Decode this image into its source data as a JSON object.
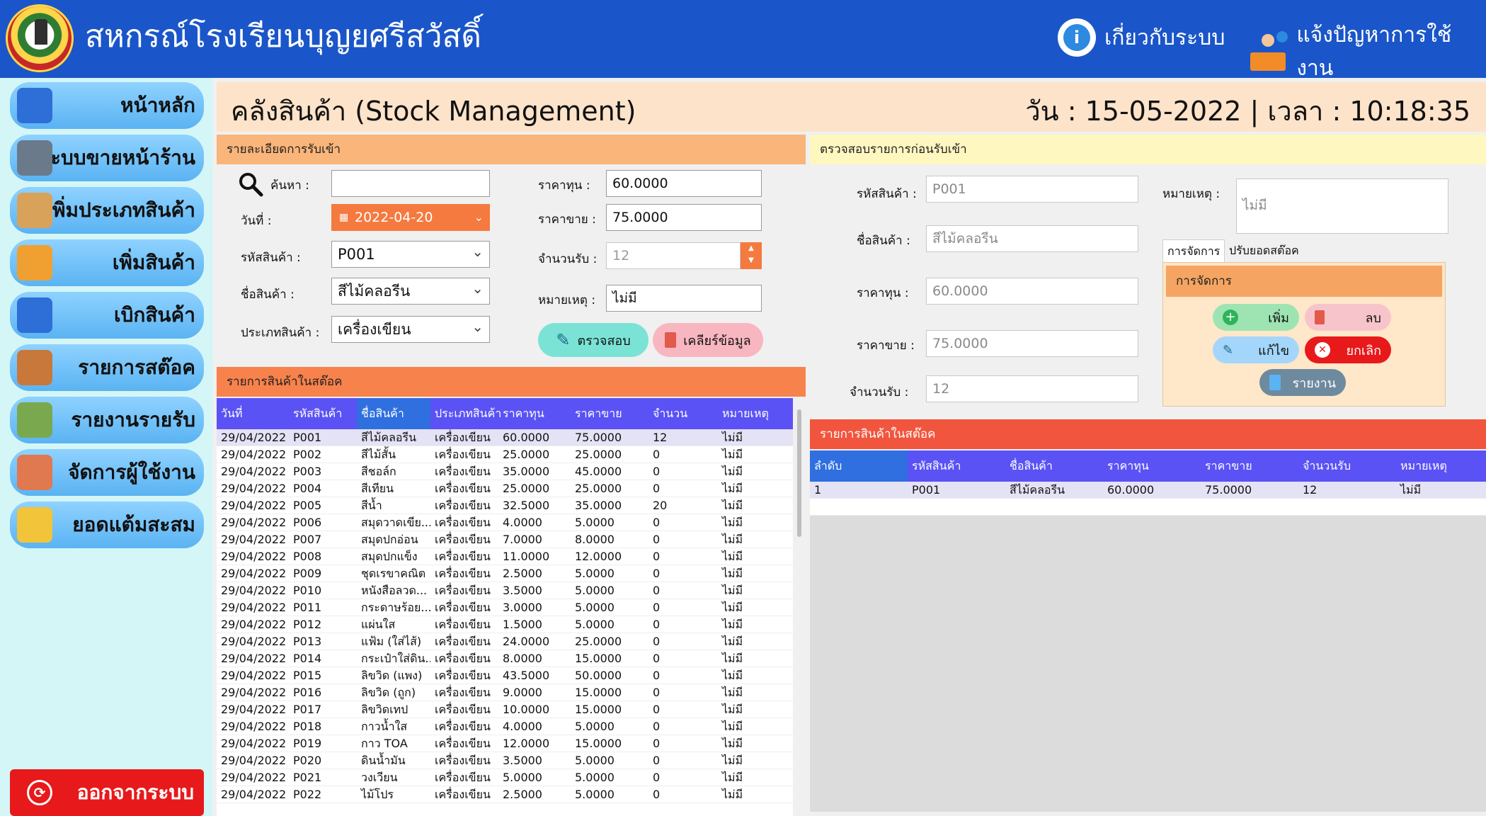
{
  "app": {
    "title": "สหกรณ์โรงเรียนบุญยศรีสวัสดิ์",
    "about_label": "เกี่ยวกับระบบ",
    "report_issue_label": "แจ้งปัญหาการใช้งาน"
  },
  "sidebar": {
    "items": [
      {
        "label": "หน้าหลัก",
        "icon": "dashboard-icon",
        "color": "#2d6fd6"
      },
      {
        "label": "ระบบขายหน้าร้าน",
        "icon": "cash-register-icon",
        "color": "#6b7a8a"
      },
      {
        "label": "เพิ่มประเภทสินค้า",
        "icon": "shelf-icon",
        "color": "#d9a25a"
      },
      {
        "label": "เพิ่มสินค้า",
        "icon": "basket-add-icon",
        "color": "#f0a030"
      },
      {
        "label": "เบิกสินค้า",
        "icon": "share-icon",
        "color": "#2d6fd6"
      },
      {
        "label": "รายการสต๊อค",
        "icon": "boxes-icon",
        "color": "#c8783a"
      },
      {
        "label": "รายงานรายรับ",
        "icon": "calculator-icon",
        "color": "#7aa84e"
      },
      {
        "label": "จัดการผู้ใช้งาน",
        "icon": "users-icon",
        "color": "#e07850"
      },
      {
        "label": "ยอดแต้มสะสม",
        "icon": "star-hand-icon",
        "color": "#f2c43a"
      }
    ],
    "logout_label": "ออกจากระบบ"
  },
  "header": {
    "title": "คลังสินค้า (Stock Management)",
    "datetime": "วัน : 15-05-2022 | เวลา : 10:18:35"
  },
  "receive_form": {
    "section_title": "รายละเอียดการรับเข้า",
    "search_label": "ค้นหา :",
    "search_value": "",
    "date_label": "วันที่ :",
    "date_value": "2022-04-20",
    "code_label": "รหัสสินค้า :",
    "code_value": "P001",
    "name_label": "ชื่อสินค้า :",
    "name_value": "สีไม้คลอรีน",
    "category_label": "ประเภทสินค้า :",
    "category_value": "เครื่องเขียน",
    "cost_label": "ราคาทุน :",
    "cost_value": "60.0000",
    "price_label": "ราคาขาย :",
    "price_value": "75.0000",
    "qty_label": "จำนวนรับ :",
    "qty_value": "12",
    "note_label": "หมายเหตุ :",
    "note_value": "ไม่มี",
    "check_button": "ตรวจสอบ",
    "clear_button": "เคลียร์ข้อมูล"
  },
  "stock_table": {
    "section_title": "รายการสินค้าในสต๊อค",
    "columns": [
      "วันที่",
      "รหัสสินค้า",
      "ชื่อสินค้า",
      "ประเภทสินค้า",
      "ราคาทุน",
      "ราคาขาย",
      "จำนวน",
      "หมายเหตุ"
    ],
    "rows": [
      [
        "29/04/2022",
        "P001",
        "สีไม้คลอรีน",
        "เครื่องเขียน",
        "60.0000",
        "75.0000",
        "12",
        "ไม่มี"
      ],
      [
        "29/04/2022",
        "P002",
        "สีไม้สั้น",
        "เครื่องเขียน",
        "25.0000",
        "25.0000",
        "0",
        "ไม่มี"
      ],
      [
        "29/04/2022",
        "P003",
        "สีชอล์ก",
        "เครื่องเขียน",
        "35.0000",
        "45.0000",
        "0",
        "ไม่มี"
      ],
      [
        "29/04/2022",
        "P004",
        "สีเทียน",
        "เครื่องเขียน",
        "25.0000",
        "25.0000",
        "0",
        "ไม่มี"
      ],
      [
        "29/04/2022",
        "P005",
        "สีน้ำ",
        "เครื่องเขียน",
        "32.5000",
        "35.0000",
        "20",
        "ไม่มี"
      ],
      [
        "29/04/2022",
        "P006",
        "สมุดวาดเขีย...",
        "เครื่องเขียน",
        "4.0000",
        "5.0000",
        "0",
        "ไม่มี"
      ],
      [
        "29/04/2022",
        "P007",
        "สมุดปกอ่อน",
        "เครื่องเขียน",
        "7.0000",
        "8.0000",
        "0",
        "ไม่มี"
      ],
      [
        "29/04/2022",
        "P008",
        "สมุดปกแข็ง",
        "เครื่องเขียน",
        "11.0000",
        "12.0000",
        "0",
        "ไม่มี"
      ],
      [
        "29/04/2022",
        "P009",
        "ชุดเรขาคณิต",
        "เครื่องเขียน",
        "2.5000",
        "5.0000",
        "0",
        "ไม่มี"
      ],
      [
        "29/04/2022",
        "P010",
        "หนังสือลวด...",
        "เครื่องเขียน",
        "3.5000",
        "5.0000",
        "0",
        "ไม่มี"
      ],
      [
        "29/04/2022",
        "P011",
        "กระดาษร้อย...",
        "เครื่องเขียน",
        "3.0000",
        "5.0000",
        "0",
        "ไม่มี"
      ],
      [
        "29/04/2022",
        "P012",
        "แผ่นใส",
        "เครื่องเขียน",
        "1.5000",
        "5.0000",
        "0",
        "ไม่มี"
      ],
      [
        "29/04/2022",
        "P013",
        "แฟ้ม (ใส่ไส้)",
        "เครื่องเขียน",
        "24.0000",
        "25.0000",
        "0",
        "ไม่มี"
      ],
      [
        "29/04/2022",
        "P014",
        "กระเป๋าใส่ดิน...",
        "เครื่องเขียน",
        "8.0000",
        "15.0000",
        "0",
        "ไม่มี"
      ],
      [
        "29/04/2022",
        "P015",
        "ลิขวิด (แพง)",
        "เครื่องเขียน",
        "43.5000",
        "50.0000",
        "0",
        "ไม่มี"
      ],
      [
        "29/04/2022",
        "P016",
        "ลิขวิด (ถูก)",
        "เครื่องเขียน",
        "9.0000",
        "15.0000",
        "0",
        "ไม่มี"
      ],
      [
        "29/04/2022",
        "P017",
        "ลิขวิดเทป",
        "เครื่องเขียน",
        "10.0000",
        "15.0000",
        "0",
        "ไม่มี"
      ],
      [
        "29/04/2022",
        "P018",
        "กาวน้ำใส",
        "เครื่องเขียน",
        "4.0000",
        "5.0000",
        "0",
        "ไม่มี"
      ],
      [
        "29/04/2022",
        "P019",
        "กาว TOA",
        "เครื่องเขียน",
        "12.0000",
        "15.0000",
        "0",
        "ไม่มี"
      ],
      [
        "29/04/2022",
        "P020",
        "ดินน้ำมัน",
        "เครื่องเขียน",
        "3.5000",
        "5.0000",
        "0",
        "ไม่มี"
      ],
      [
        "29/04/2022",
        "P021",
        "วงเวียน",
        "เครื่องเขียน",
        "5.0000",
        "5.0000",
        "0",
        "ไม่มี"
      ],
      [
        "29/04/2022",
        "P022",
        "ไม้โปร",
        "เครื่องเขียน",
        "2.5000",
        "5.0000",
        "0",
        "ไม่มี"
      ]
    ]
  },
  "check_panel": {
    "section_title": "ตรวจสอบรายการก่อนรับเข้า",
    "code_label": "รหัสสินค้า :",
    "code_value": "P001",
    "name_label": "ชื่อสินค้า :",
    "name_value": "สีไม้คลอรีน",
    "cost_label": "ราคาทุน :",
    "cost_value": "60.0000",
    "price_label": "ราคาขาย :",
    "price_value": "75.0000",
    "qty_label": "จำนวนรับ :",
    "qty_value": "12",
    "note_label": "หมายเหตุ :",
    "note_value": "ไม่มี",
    "tabs": [
      "การจัดการ",
      "ปรับยอดสต๊อค"
    ],
    "actions_title": "การจัดการ",
    "add_button": "เพิ่ม",
    "delete_button": "ลบ",
    "edit_button": "แก้ไข",
    "cancel_button": "ยกเลิก",
    "report_button": "รายงาน"
  },
  "pending_table": {
    "section_title": "รายการสินค้าในสต๊อค",
    "columns": [
      "ลำดับ",
      "รหัสสินค้า",
      "ชื่อสินค้า",
      "ราคาทุน",
      "ราคาขาย",
      "จำนวนรับ",
      "หมายเหตุ"
    ],
    "rows": [
      [
        "1",
        "P001",
        "สีไม้คลอรีน",
        "60.0000",
        "75.0000",
        "12",
        "ไม่มี"
      ]
    ]
  },
  "colors": {
    "topbar": "#1a56c9",
    "sidebar_bg": "#d4f6f7",
    "header_bg": "#fde3c9",
    "table_header": "#5b52f5",
    "logout": "#e8191b",
    "date_picker": "#f47a3f"
  }
}
